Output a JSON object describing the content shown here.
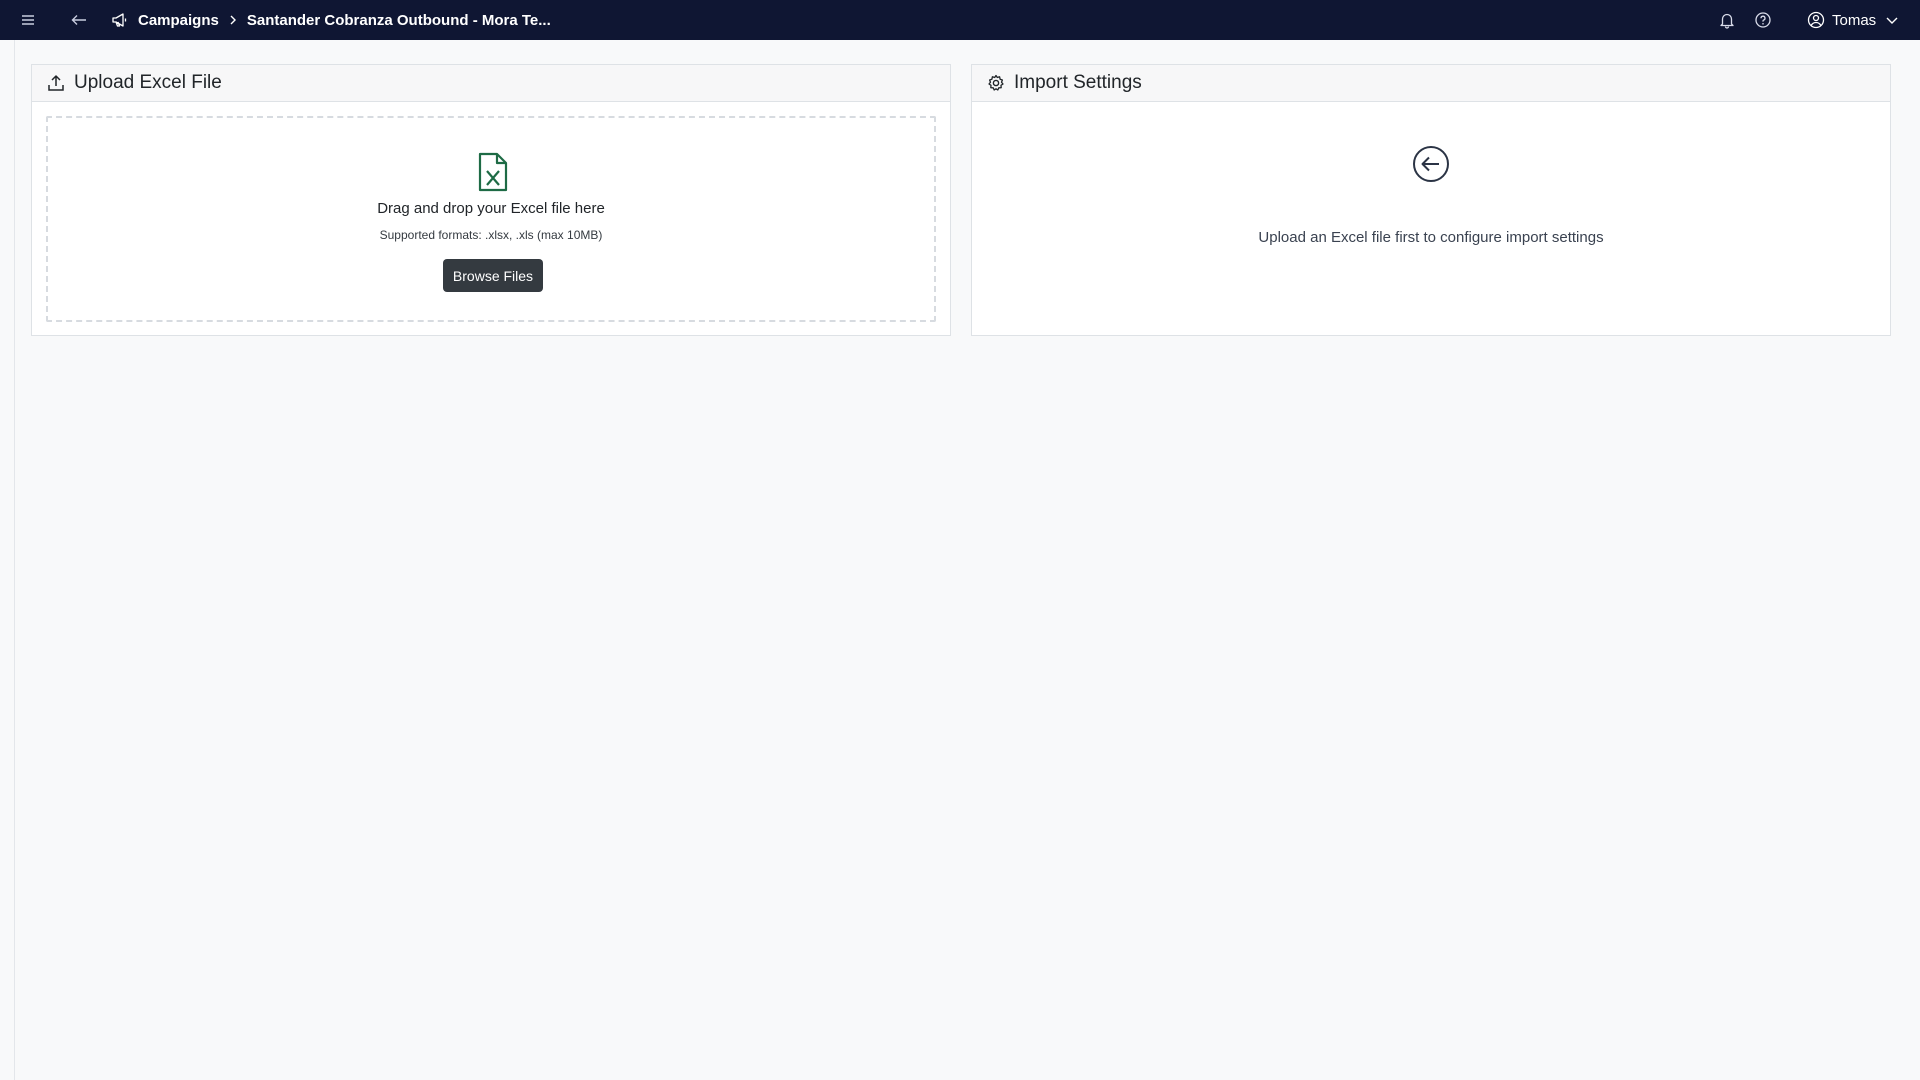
{
  "topbar": {
    "menu_icon": "hamburger-icon",
    "back_icon": "arrow-left-icon",
    "breadcrumb": {
      "icon": "megaphone-icon",
      "items": [
        "Campaigns",
        "Santander Cobranza Outbound - Mora Te..."
      ],
      "separator_icon": "chevron-right-icon"
    },
    "bell_icon": "bell-icon",
    "help_icon": "help-circle-icon",
    "user": {
      "name": "Tomas",
      "icon": "user-circle-icon",
      "chevron_icon": "chevron-down-icon"
    },
    "background_color": "#0f1633"
  },
  "upload_card": {
    "title": "Upload Excel File",
    "title_icon": "upload-icon",
    "dropzone": {
      "icon": "excel-file-icon",
      "title": "Drag and drop your Excel file here",
      "subtitle": "Supported formats: .xlsx, .xls (max 10MB)",
      "button_label": "Browse Files"
    }
  },
  "settings_card": {
    "title": "Import Settings",
    "title_icon": "gear-icon",
    "empty_icon": "arrow-left-circle-icon",
    "empty_message": "Upload an Excel file first to configure import settings"
  },
  "colors": {
    "excel_green": "#1e6b45",
    "button_dark": "#343a40"
  }
}
